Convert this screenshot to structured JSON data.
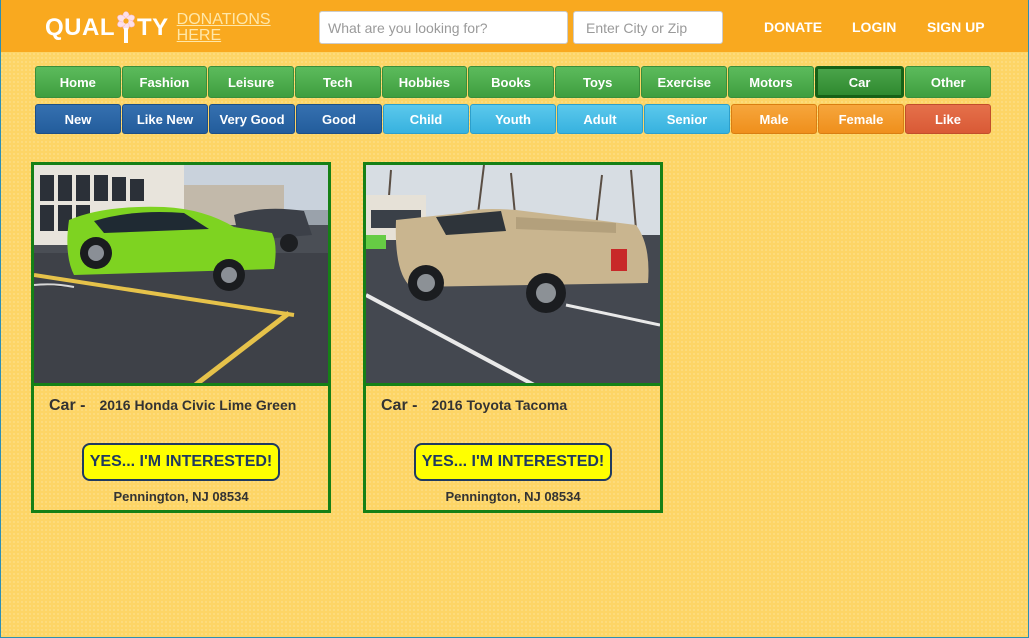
{
  "header": {
    "logo_main_left": "QUAL",
    "logo_main_right": "TY",
    "logo_sub_line1": "DONATIONS",
    "logo_sub_line2": "HERE",
    "search_placeholder": "What are you looking for?",
    "zip_placeholder": "Enter City or Zip",
    "nav": [
      "DONATE",
      "LOGIN",
      "SIGN UP"
    ]
  },
  "categories": {
    "primary": [
      "Home",
      "Fashion",
      "Leisure",
      "Tech",
      "Hobbies",
      "Books",
      "Toys",
      "Exercise",
      "Motors",
      "Car",
      "Other"
    ],
    "active": "Car",
    "secondary": [
      "New",
      "Like New",
      "Very Good",
      "Good",
      "Child",
      "Youth",
      "Adult",
      "Senior",
      "Male",
      "Female",
      "Like"
    ]
  },
  "listings": [
    {
      "category": "Car -",
      "title": "2016 Honda Civic Lime Green",
      "button": "YES... I'M INTERESTED!",
      "location": "Pennington, NJ 08534",
      "image": "lime-green-honda-civic-photo"
    },
    {
      "category": "Car -",
      "title": "2016 Toyota Tacoma",
      "button": "YES... I'M INTERESTED!",
      "location": "Pennington, NJ 08534",
      "image": "tan-toyota-tacoma-photo"
    }
  ],
  "colors": {
    "header": "#f9a91f",
    "page_bg": "#fdd566",
    "card_border": "#168016",
    "interest_button": "#ffff00"
  }
}
